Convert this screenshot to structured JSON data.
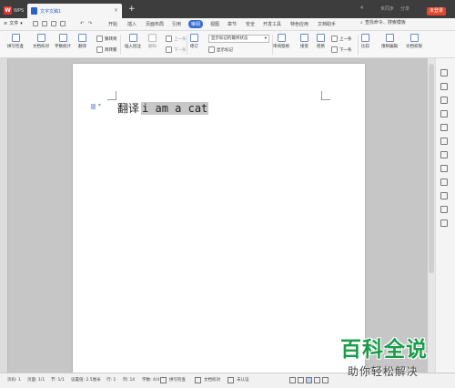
{
  "titlebar": {
    "app_logo": "W",
    "app_name": "WPS",
    "document_tab": "文字文稿1",
    "new_tab": "+",
    "right_items": [
      "4",
      "未同步",
      "分享"
    ],
    "login": "未登录"
  },
  "menubar": {
    "file": "文件",
    "items": [
      "开始",
      "插入",
      "页面布局",
      "引用",
      "审阅",
      "视图",
      "章节",
      "安全",
      "开发工具",
      "特色应用",
      "文档助手"
    ],
    "active_item": "审阅",
    "search": "查找命令、搜索模板"
  },
  "toolbar": {
    "spellcheck": "拼写检查",
    "doc_proof": "文档校对",
    "word_count": "字数统计",
    "translate": "翻译",
    "simp_to_trad": "繁转简",
    "trad_to_simp": "简转繁",
    "insert_comment": "插入批注",
    "delete": "删除",
    "prev": "上一条",
    "next": "下一条",
    "track_changes": "修订",
    "markup_select": "显示标记的最终状态",
    "show_markup": "显示标记",
    "review_pane": "审阅窗格",
    "accept": "接受",
    "reject": "拒绝",
    "prev_change": "上一条",
    "next_change": "下一条",
    "compare": "比较",
    "restrict_edit": "限制编辑",
    "doc_auth": "文档权限"
  },
  "document": {
    "prefix": "翻译",
    "selected_text": "i am a cat"
  },
  "statusbar": {
    "page_num": "页码: 1",
    "pages": "页面: 1/1",
    "section": "节: 1/1",
    "set_value": "设置值: 2.5厘米",
    "row": "行: 1",
    "col": "列: 14",
    "word_count": "字数: 4/4",
    "spellcheck": "拼写检查",
    "doc_proof": "文档校对",
    "auth": "未认证"
  },
  "watermark": {
    "title": "百科全说",
    "subtitle": "助你轻松解决"
  },
  "colors": {
    "titlebar": "#3d3d3d",
    "accent": "#3a6fd1",
    "login": "#e2462d",
    "watermark": "#1a9c4a"
  }
}
